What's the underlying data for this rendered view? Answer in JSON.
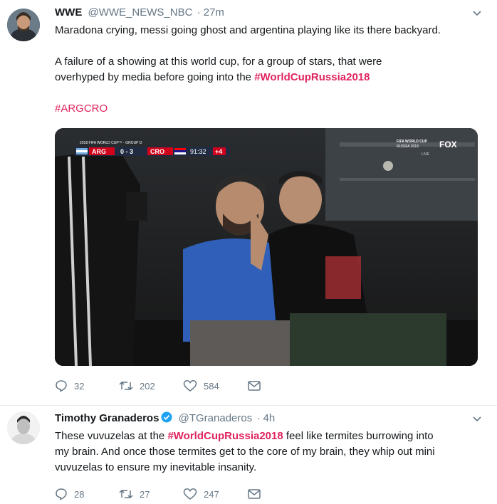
{
  "tweets": [
    {
      "name": "WWE",
      "handle": "@WWE_NEWS_NBC",
      "time": "· 27m",
      "text_line1": "Maradona crying, messi going ghost and argentina playing like its there backyard.",
      "text_line2": "A failure of a showing at this world cup, for a group of stars, that were",
      "text_line3_pre": "overhyped by media before going into the ",
      "text_line3_hashtag": "#WorldCupRussia2018",
      "text_line4_hashtag": "#ARGCRO",
      "scoreboard": {
        "event": "2018 FIFA WORLD CUP™ · GROUP D",
        "team1": "ARG",
        "score": "0 - 3",
        "team2": "CRO",
        "clock": "91:32",
        "added": "+4"
      },
      "broadcast": {
        "logo_line1": "FIFA WORLD CUP",
        "logo_line2": "RUSSIA 2018",
        "network": "FOX",
        "live": "LIVE"
      },
      "replies": "32",
      "retweets": "202",
      "likes": "584"
    },
    {
      "name": "Timothy Granaderos",
      "handle": "@TGranaderos",
      "time": "· 4h",
      "text_line1_pre": "These vuvuzelas at the ",
      "text_line1_hashtag": "#WorldCupRussia2018",
      "text_line1_post": " feel like termites burrowing into",
      "text_line2": "my brain. And once those termites get to the core of my brain, they whip out mini",
      "text_line3": "vuvuzelas to ensure my inevitable insanity.",
      "replies": "28",
      "retweets": "27",
      "likes": "247"
    }
  ],
  "colors": {
    "hashtag": "#e0245e",
    "meta": "#657786",
    "verified": "#1da1f2"
  }
}
